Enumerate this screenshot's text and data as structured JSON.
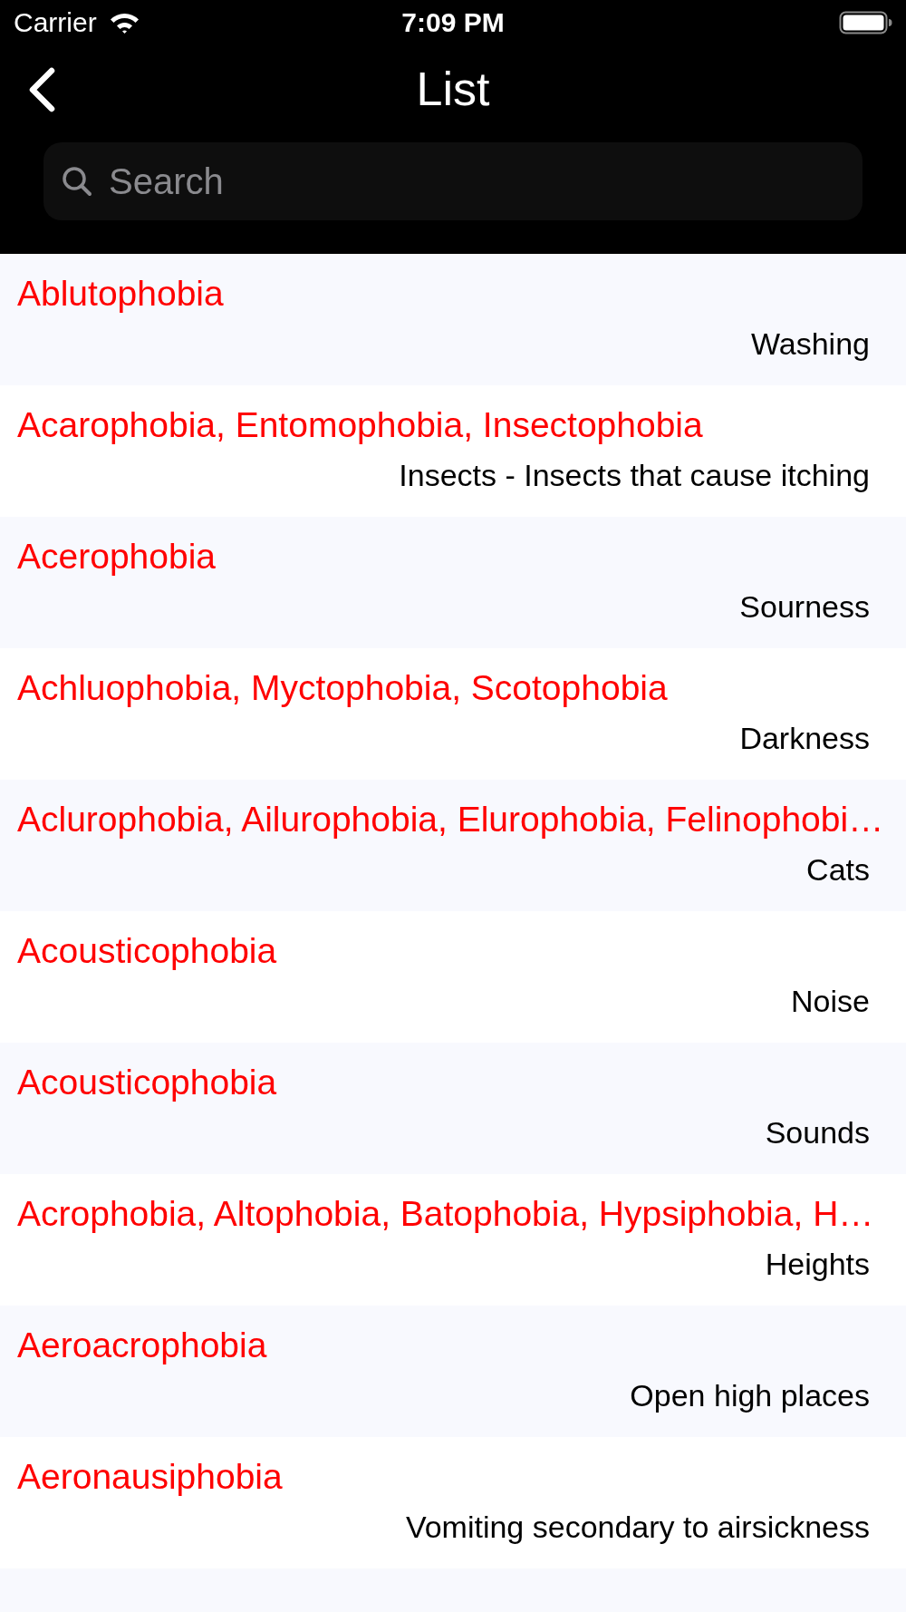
{
  "status_bar": {
    "carrier": "Carrier",
    "time": "7:09 PM"
  },
  "nav_bar": {
    "title": "List"
  },
  "search": {
    "placeholder": "Search"
  },
  "rows": [
    {
      "title": "Ablutophobia",
      "subtitle": "Washing"
    },
    {
      "title": "Acarophobia, Entomophobia, Insectophobia",
      "subtitle": "Insects - Insects that cause itching"
    },
    {
      "title": "Acerophobia",
      "subtitle": "Sourness"
    },
    {
      "title": "Achluophobia, Myctophobia, Scotophobia",
      "subtitle": "Darkness"
    },
    {
      "title": "Aclurophobia, Ailurophobia, Elurophobia, Felinophobi…",
      "subtitle": "Cats"
    },
    {
      "title": "Acousticophobia",
      "subtitle": "Noise"
    },
    {
      "title": "Acousticophobia",
      "subtitle": "Sounds"
    },
    {
      "title": "Acrophobia, Altophobia, Batophobia, Hypsiphobia, H…",
      "subtitle": "Heights"
    },
    {
      "title": "Aeroacrophobia",
      "subtitle": "Open high places"
    },
    {
      "title": "Aeronausiphobia",
      "subtitle": "Vomiting secondary to airsickness"
    }
  ]
}
